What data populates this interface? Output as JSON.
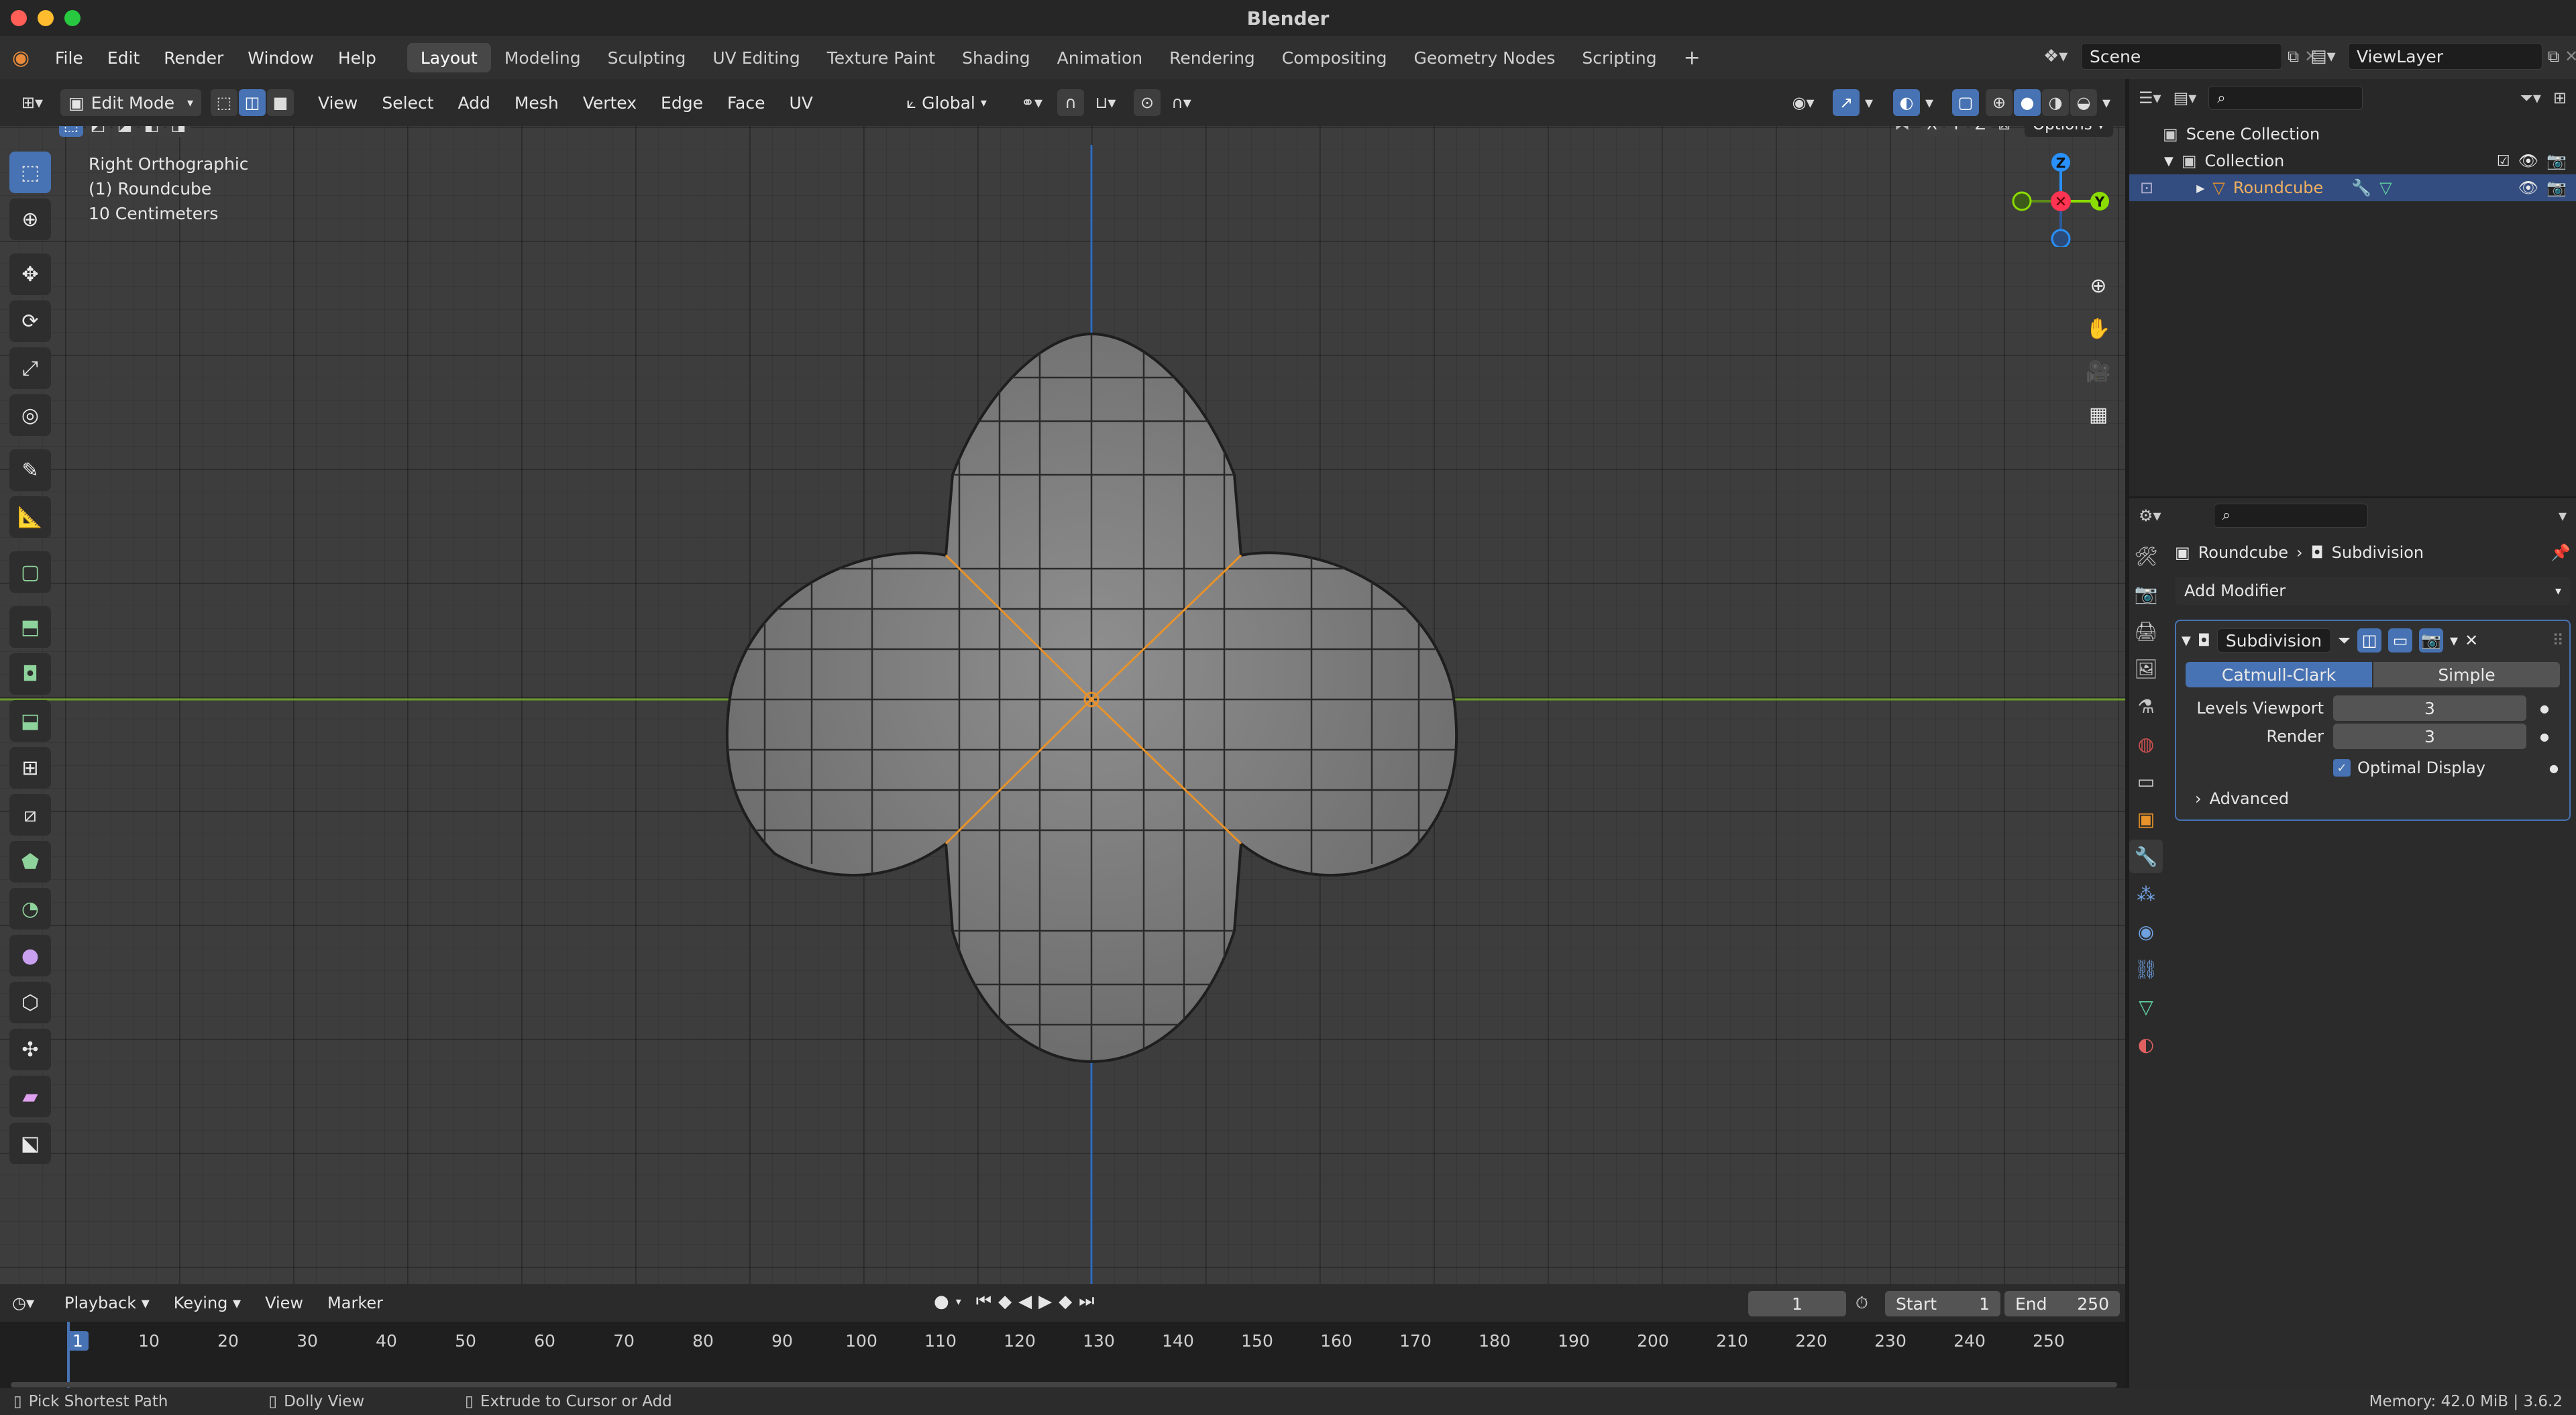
{
  "title": "Blender",
  "menus": [
    "File",
    "Edit",
    "Render",
    "Window",
    "Help"
  ],
  "workspaces": [
    "Layout",
    "Modeling",
    "Sculpting",
    "UV Editing",
    "Texture Paint",
    "Shading",
    "Animation",
    "Rendering",
    "Compositing",
    "Geometry Nodes",
    "Scripting"
  ],
  "active_workspace": "Layout",
  "scene": "Scene",
  "view_layer": "ViewLayer",
  "viewport_header": {
    "mode": "Edit Mode",
    "menus": [
      "View",
      "Select",
      "Add",
      "Mesh",
      "Vertex",
      "Edge",
      "Face",
      "UV"
    ],
    "transform_orientation": "Global",
    "options_label": "Options",
    "axes": [
      "X",
      "Y",
      "Z"
    ]
  },
  "viewport_overlay": {
    "view_name": "Right Orthographic",
    "object_label": "(1) Roundcube",
    "scale_label": "10 Centimeters"
  },
  "gizmo": {
    "z": "Z",
    "y": "Y"
  },
  "outliner": {
    "scene_collection": "Scene Collection",
    "collection": "Collection",
    "object": "Roundcube"
  },
  "properties": {
    "breadcrumb_object": "Roundcube",
    "breadcrumb_modifier": "Subdivision",
    "add_modifier": "Add Modifier",
    "modifier_name": "Subdivision",
    "mode_catmull": "Catmull-Clark",
    "mode_simple": "Simple",
    "levels_viewport_label": "Levels Viewport",
    "levels_viewport_value": "3",
    "render_label": "Render",
    "render_value": "3",
    "optimal_display": "Optimal Display",
    "advanced": "Advanced"
  },
  "timeline": {
    "menus": [
      "Playback",
      "Keying",
      "View",
      "Marker"
    ],
    "current_frame": "1",
    "start_label": "Start",
    "start_value": "1",
    "end_label": "End",
    "end_value": "250",
    "ticks": [
      "1",
      "10",
      "20",
      "30",
      "40",
      "50",
      "60",
      "70",
      "80",
      "90",
      "100",
      "110",
      "120",
      "130",
      "140",
      "150",
      "160",
      "170",
      "180",
      "190",
      "200",
      "210",
      "220",
      "230",
      "240",
      "250"
    ]
  },
  "status": {
    "left": "Pick Shortest Path",
    "middle": "Dolly View",
    "right_action": "Extrude to Cursor or Add",
    "memory": "Memory: 42.0 MiB | 3.6.2"
  },
  "colors": {
    "accent": "#4772b3",
    "selected_edge": "#f0a030",
    "x_axis": "#ff3352",
    "y_axis": "#8bdc00",
    "z_axis": "#2890ff"
  }
}
